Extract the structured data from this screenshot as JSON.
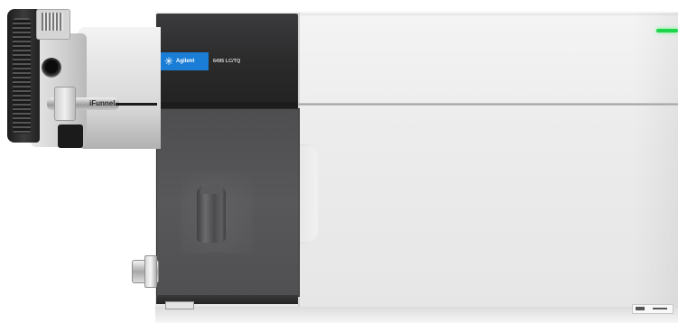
{
  "instrument": {
    "brand": "Agilent",
    "model": "6495 LC/TQ",
    "callout_label": "iFunnel"
  },
  "colors": {
    "brand_badge": "#1a7ed6",
    "status_led": "#1fd44a",
    "top_panel": "#2a2a2b",
    "door_tint": "#555557",
    "body": "#eeeeee"
  },
  "icons": {
    "brand_logo": "spark-icon"
  }
}
